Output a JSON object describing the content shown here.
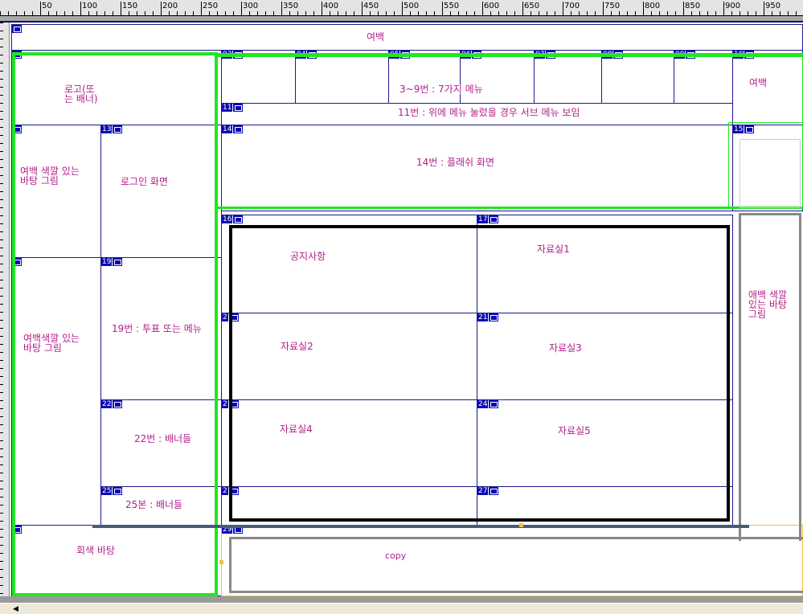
{
  "ruler": {
    "marks": [
      "50",
      "100",
      "150",
      "200",
      "250",
      "300",
      "350",
      "400",
      "450",
      "500",
      "550",
      "600",
      "650",
      "700",
      "750",
      "800",
      "850",
      "900",
      "950"
    ]
  },
  "colors": {
    "cell_border": "#1a1a8c",
    "label": "#b0208a",
    "tag": "#0a0ab4",
    "green": "#22e622",
    "black_frame": "#000000",
    "gray_frame": "#888888"
  },
  "cells": {
    "top": {
      "tag": "",
      "label": "여백"
    },
    "logo": {
      "tag": "",
      "label": "로고(또\n는 배너)"
    },
    "menus": [
      {
        "tag": "03"
      },
      {
        "tag": "04"
      },
      {
        "tag": "05"
      },
      {
        "tag": "06"
      },
      {
        "tag": "07"
      },
      {
        "tag": "08"
      },
      {
        "tag": "09"
      }
    ],
    "menu_label": "3~9번 : 7가지 메뉴",
    "c10": {
      "tag": "10",
      "label": "여백"
    },
    "c11": {
      "tag": "11",
      "label": "11번 : 위에 메뉴 눌렀을 경우 서브 메뉴 보임"
    },
    "c12": {
      "tag": "",
      "label": "여백 색깔 있는\n바탕 그림"
    },
    "c13": {
      "tag": "13",
      "label": "로그인 화면"
    },
    "c14": {
      "tag": "14",
      "label": "14번 : 플래쉬 화면"
    },
    "c15": {
      "tag": "15"
    },
    "c18": {
      "tag": "",
      "label": "여백색깔 있는\n바탕 그림"
    },
    "c19": {
      "tag": "19",
      "label": "19번 : 투표 또는 메뉴"
    },
    "c22": {
      "tag": "22",
      "label": "22번 : 배너들"
    },
    "c25": {
      "tag": "25",
      "label": "25본 : 배너들"
    },
    "c16": {
      "tag": "16",
      "label": "공지사항"
    },
    "c17": {
      "tag": "17",
      "label": "자료실1"
    },
    "c20": {
      "tag": "2",
      "label": "자료실2"
    },
    "c21": {
      "tag": "21",
      "label": "자료실3"
    },
    "c23": {
      "tag": "2",
      "label": "자료실4"
    },
    "c24": {
      "tag": "24",
      "label": "자료실5"
    },
    "c26": {
      "tag": "2"
    },
    "c27": {
      "tag": "27"
    },
    "right": {
      "label": "애백 색깔\n있는 바탕\n그림"
    },
    "c28": {
      "tag": "",
      "label": "회색 바탕"
    },
    "c29": {
      "tag": "29",
      "label": "copy"
    }
  }
}
